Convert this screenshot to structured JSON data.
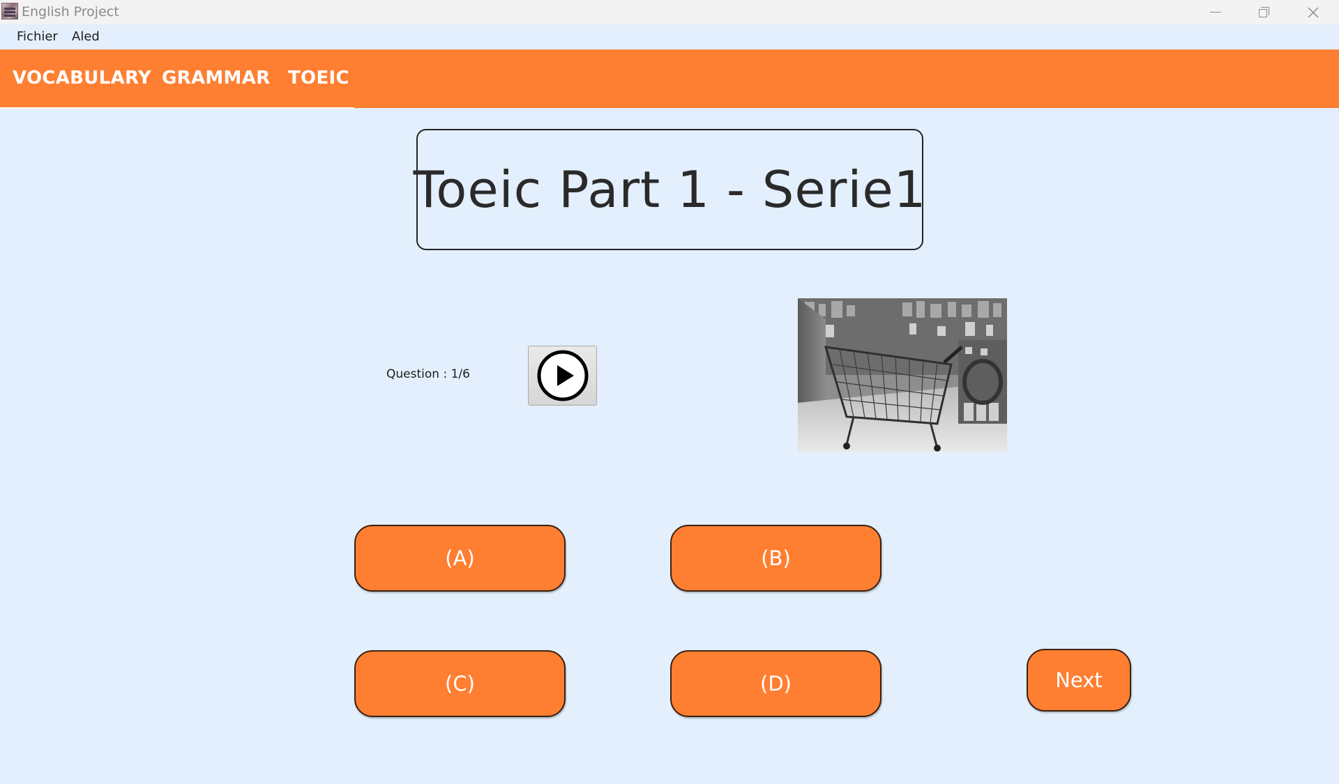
{
  "window": {
    "title": "English Project",
    "icon": "app-logo-icon",
    "controls": [
      "minimize-icon",
      "restore-icon",
      "close-icon"
    ]
  },
  "menu": {
    "items": [
      {
        "label": "Fichier"
      },
      {
        "label": "Aled"
      }
    ]
  },
  "nav": {
    "tabs": [
      {
        "label": "VOCABULARY"
      },
      {
        "label": "GRAMMAR"
      },
      {
        "label": "TOEIC"
      }
    ],
    "accent_color": "#ff7f32"
  },
  "quiz": {
    "title": "Toeic Part 1 - Serie1",
    "question_label": "Question : 1/6",
    "play_icon": "play-icon",
    "photo_subject": "shopping cart in store aisle (grayscale)",
    "answers": [
      {
        "label": "(A)"
      },
      {
        "label": "(B)"
      },
      {
        "label": "(C)"
      },
      {
        "label": "(D)"
      }
    ],
    "next_label": "Next"
  }
}
